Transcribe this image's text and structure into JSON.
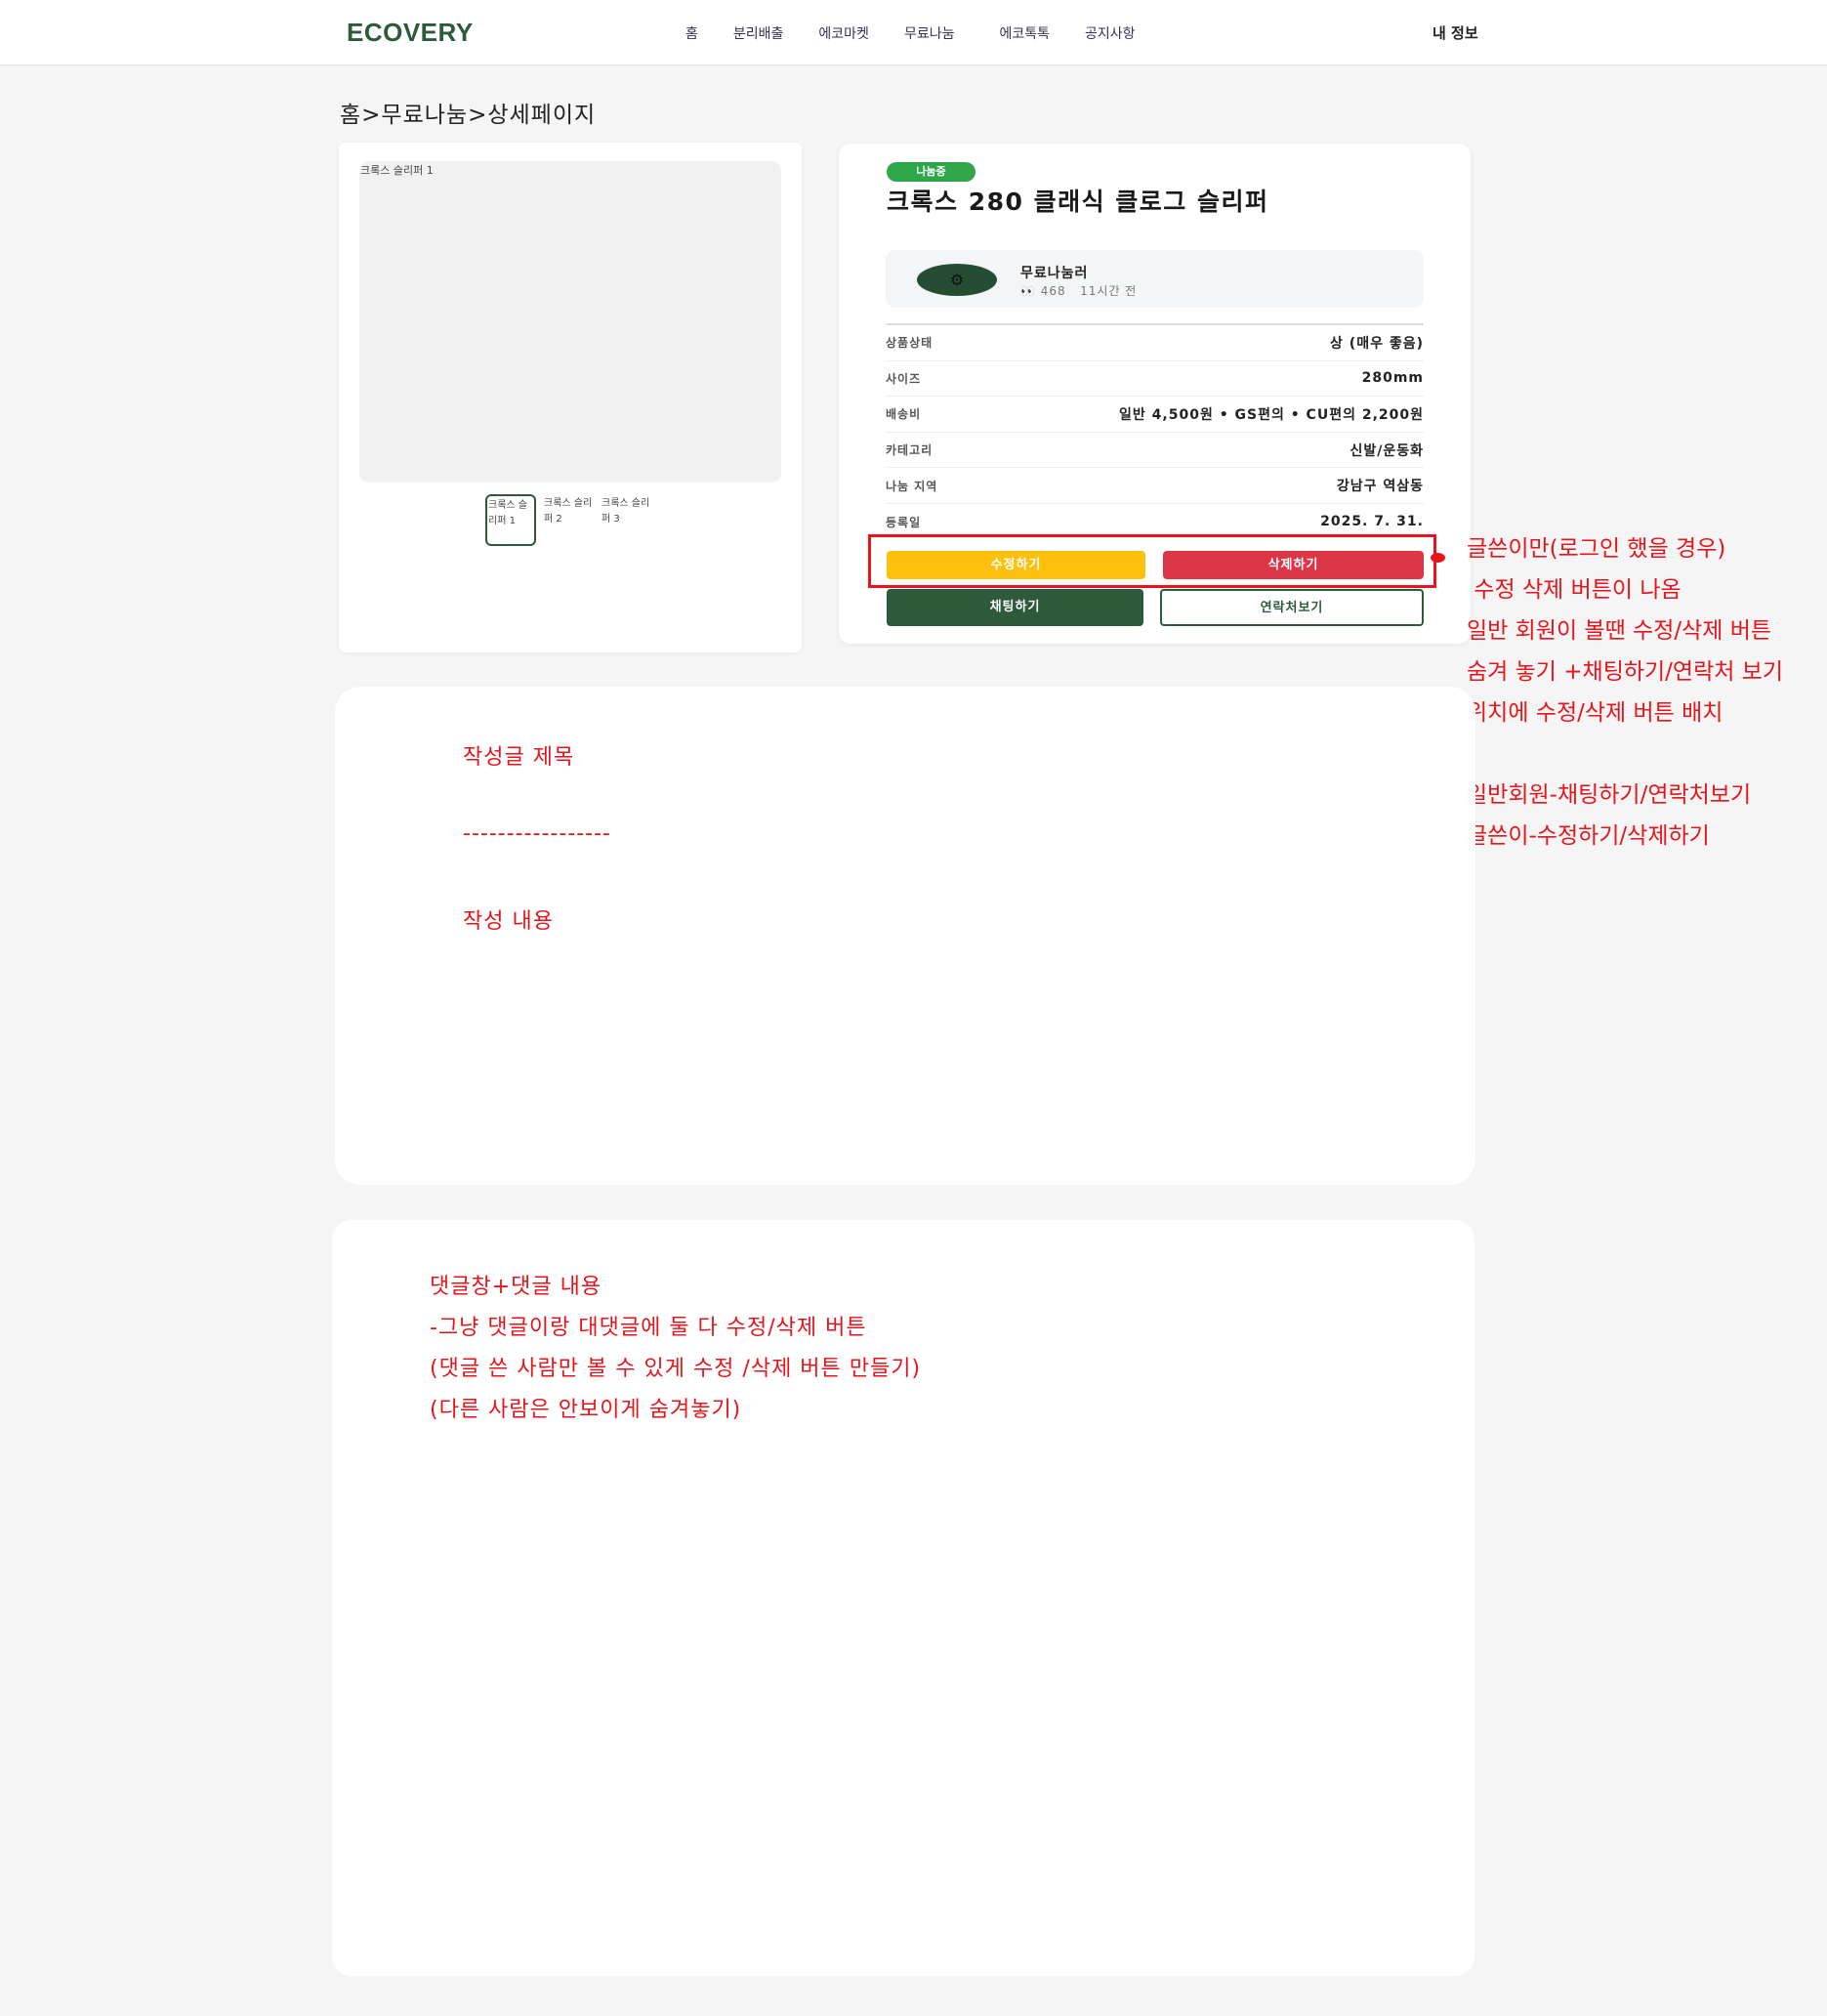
{
  "header": {
    "logo": "ECOVERY",
    "nav": [
      "홈",
      "분리배출",
      "에코마켓",
      "무료나눔",
      "에코톡톡",
      "공지사항"
    ],
    "my_info": "내 정보"
  },
  "breadcrumb": "홈>무료나눔>상세페이지",
  "gallery": {
    "main_alt": "크록스 슬리퍼 1",
    "thumbs": [
      "크록스 슬리퍼 1",
      "크록스 슬리퍼 2",
      "크록스 슬리퍼 3"
    ]
  },
  "product": {
    "badge": "나눔중",
    "title": "크록스 280 클래식 클로그 슬리퍼",
    "seller": {
      "name": "무료나눔러",
      "views_icon": "👀",
      "views": "468",
      "time": "11시간 전"
    },
    "specs": [
      {
        "label": "상품상태",
        "value": "상 (매우 좋음)"
      },
      {
        "label": "사이즈",
        "value": "280mm"
      },
      {
        "label": "배송비",
        "value": "일반 4,500원 • GS편의 • CU편의 2,200원"
      },
      {
        "label": "카테고리",
        "value": "신발/운동화"
      },
      {
        "label": "나눔 지역",
        "value": "강남구 역삼동"
      },
      {
        "label": "등록일",
        "value": "2025. 7. 31."
      }
    ],
    "buttons": {
      "edit": "수정하기",
      "delete": "삭제하기",
      "chat": "채팅하기",
      "contact": "연락처보기"
    }
  },
  "annotation": {
    "note": "글쓴이만(로그인 했을 경우)\n 수정 삭제 버튼이 나옴\n일반 회원이 볼땐 수정/삭제 버튼\n숨겨 놓기 +채팅하기/연락처 보기\n위치에 수정/삭제 버튼 배치\n\n일반회원-채팅하기/연락처보기\n글쓴이-수정하기/삭제하기"
  },
  "content": {
    "title": "작성글 제목",
    "divider": "-----------------",
    "body": "작성 내용"
  },
  "comments": {
    "note": "댓글창+댓글 내용\n-그냥 댓글이랑 대댓글에 둘 다 수정/삭제 버튼\n(댓글 쓴 사람만 볼 수 있게 수정 /삭제 버튼 만들기)\n(다른 사람은 안보이게 숨겨놓기)"
  },
  "colors": {
    "brand": "#2d5a3b",
    "badge": "#2ea64a",
    "edit": "#fdc00c",
    "delete": "#dc3545",
    "annotation": "#e8141b"
  }
}
